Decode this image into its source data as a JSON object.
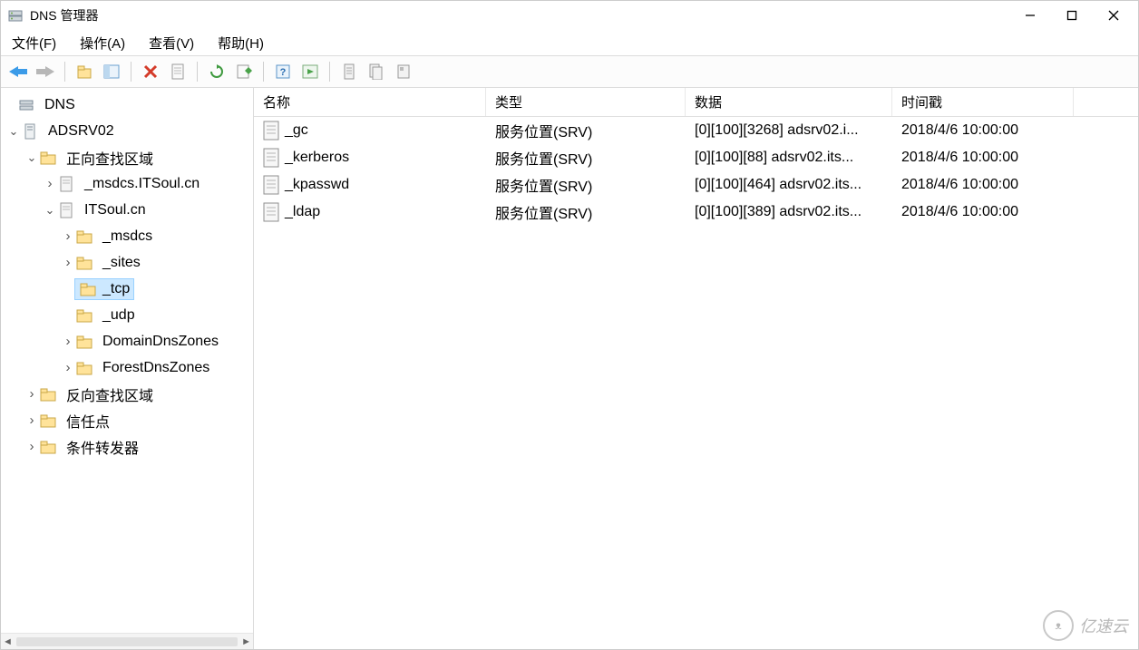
{
  "window": {
    "title": "DNS 管理器"
  },
  "menus": {
    "file": "文件(F)",
    "action": "操作(A)",
    "view": "查看(V)",
    "help": "帮助(H)"
  },
  "tree": {
    "root": "DNS",
    "server": "ADSRV02",
    "fwd_zone_group": "正向查找区域",
    "zone_msdcs_root": "_msdcs.ITSoul.cn",
    "zone_itsoul": "ITSoul.cn",
    "sub_msdcs": "_msdcs",
    "sub_sites": "_sites",
    "sub_tcp": "_tcp",
    "sub_udp": "_udp",
    "sub_domaindns": "DomainDnsZones",
    "sub_forestdns": "ForestDnsZones",
    "rev_zone_group": "反向查找区域",
    "trust_points": "信任点",
    "cond_fwd": "条件转发器"
  },
  "columns": {
    "name": "名称",
    "type": "类型",
    "data": "数据",
    "timestamp": "时间戳"
  },
  "rows": [
    {
      "name": "_gc",
      "type": "服务位置(SRV)",
      "data": "[0][100][3268] adsrv02.i...",
      "ts": "2018/4/6 10:00:00"
    },
    {
      "name": "_kerberos",
      "type": "服务位置(SRV)",
      "data": "[0][100][88] adsrv02.its...",
      "ts": "2018/4/6 10:00:00"
    },
    {
      "name": "_kpasswd",
      "type": "服务位置(SRV)",
      "data": "[0][100][464] adsrv02.its...",
      "ts": "2018/4/6 10:00:00"
    },
    {
      "name": "_ldap",
      "type": "服务位置(SRV)",
      "data": "[0][100][389] adsrv02.its...",
      "ts": "2018/4/6 10:00:00"
    }
  ],
  "watermark": {
    "text": "亿速云"
  }
}
